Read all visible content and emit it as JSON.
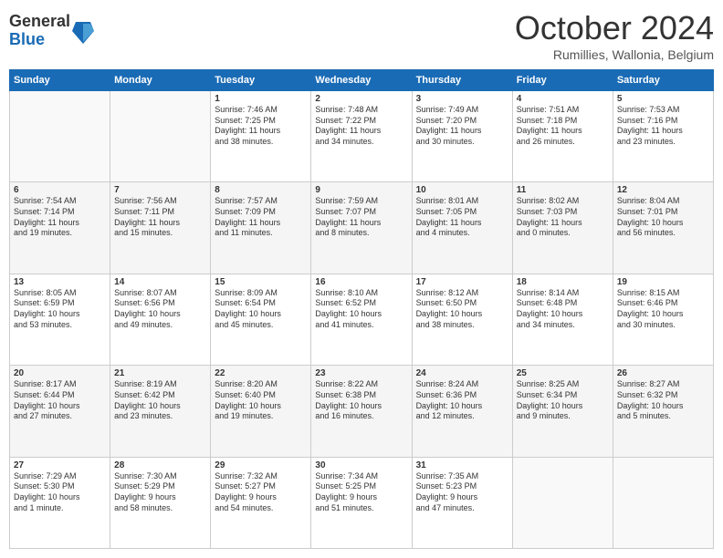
{
  "header": {
    "logo_line1": "General",
    "logo_line2": "Blue",
    "month": "October 2024",
    "location": "Rumillies, Wallonia, Belgium"
  },
  "weekdays": [
    "Sunday",
    "Monday",
    "Tuesday",
    "Wednesday",
    "Thursday",
    "Friday",
    "Saturday"
  ],
  "rows": [
    [
      {
        "day": "",
        "lines": []
      },
      {
        "day": "",
        "lines": []
      },
      {
        "day": "1",
        "lines": [
          "Sunrise: 7:46 AM",
          "Sunset: 7:25 PM",
          "Daylight: 11 hours",
          "and 38 minutes."
        ]
      },
      {
        "day": "2",
        "lines": [
          "Sunrise: 7:48 AM",
          "Sunset: 7:22 PM",
          "Daylight: 11 hours",
          "and 34 minutes."
        ]
      },
      {
        "day": "3",
        "lines": [
          "Sunrise: 7:49 AM",
          "Sunset: 7:20 PM",
          "Daylight: 11 hours",
          "and 30 minutes."
        ]
      },
      {
        "day": "4",
        "lines": [
          "Sunrise: 7:51 AM",
          "Sunset: 7:18 PM",
          "Daylight: 11 hours",
          "and 26 minutes."
        ]
      },
      {
        "day": "5",
        "lines": [
          "Sunrise: 7:53 AM",
          "Sunset: 7:16 PM",
          "Daylight: 11 hours",
          "and 23 minutes."
        ]
      }
    ],
    [
      {
        "day": "6",
        "lines": [
          "Sunrise: 7:54 AM",
          "Sunset: 7:14 PM",
          "Daylight: 11 hours",
          "and 19 minutes."
        ]
      },
      {
        "day": "7",
        "lines": [
          "Sunrise: 7:56 AM",
          "Sunset: 7:11 PM",
          "Daylight: 11 hours",
          "and 15 minutes."
        ]
      },
      {
        "day": "8",
        "lines": [
          "Sunrise: 7:57 AM",
          "Sunset: 7:09 PM",
          "Daylight: 11 hours",
          "and 11 minutes."
        ]
      },
      {
        "day": "9",
        "lines": [
          "Sunrise: 7:59 AM",
          "Sunset: 7:07 PM",
          "Daylight: 11 hours",
          "and 8 minutes."
        ]
      },
      {
        "day": "10",
        "lines": [
          "Sunrise: 8:01 AM",
          "Sunset: 7:05 PM",
          "Daylight: 11 hours",
          "and 4 minutes."
        ]
      },
      {
        "day": "11",
        "lines": [
          "Sunrise: 8:02 AM",
          "Sunset: 7:03 PM",
          "Daylight: 11 hours",
          "and 0 minutes."
        ]
      },
      {
        "day": "12",
        "lines": [
          "Sunrise: 8:04 AM",
          "Sunset: 7:01 PM",
          "Daylight: 10 hours",
          "and 56 minutes."
        ]
      }
    ],
    [
      {
        "day": "13",
        "lines": [
          "Sunrise: 8:05 AM",
          "Sunset: 6:59 PM",
          "Daylight: 10 hours",
          "and 53 minutes."
        ]
      },
      {
        "day": "14",
        "lines": [
          "Sunrise: 8:07 AM",
          "Sunset: 6:56 PM",
          "Daylight: 10 hours",
          "and 49 minutes."
        ]
      },
      {
        "day": "15",
        "lines": [
          "Sunrise: 8:09 AM",
          "Sunset: 6:54 PM",
          "Daylight: 10 hours",
          "and 45 minutes."
        ]
      },
      {
        "day": "16",
        "lines": [
          "Sunrise: 8:10 AM",
          "Sunset: 6:52 PM",
          "Daylight: 10 hours",
          "and 41 minutes."
        ]
      },
      {
        "day": "17",
        "lines": [
          "Sunrise: 8:12 AM",
          "Sunset: 6:50 PM",
          "Daylight: 10 hours",
          "and 38 minutes."
        ]
      },
      {
        "day": "18",
        "lines": [
          "Sunrise: 8:14 AM",
          "Sunset: 6:48 PM",
          "Daylight: 10 hours",
          "and 34 minutes."
        ]
      },
      {
        "day": "19",
        "lines": [
          "Sunrise: 8:15 AM",
          "Sunset: 6:46 PM",
          "Daylight: 10 hours",
          "and 30 minutes."
        ]
      }
    ],
    [
      {
        "day": "20",
        "lines": [
          "Sunrise: 8:17 AM",
          "Sunset: 6:44 PM",
          "Daylight: 10 hours",
          "and 27 minutes."
        ]
      },
      {
        "day": "21",
        "lines": [
          "Sunrise: 8:19 AM",
          "Sunset: 6:42 PM",
          "Daylight: 10 hours",
          "and 23 minutes."
        ]
      },
      {
        "day": "22",
        "lines": [
          "Sunrise: 8:20 AM",
          "Sunset: 6:40 PM",
          "Daylight: 10 hours",
          "and 19 minutes."
        ]
      },
      {
        "day": "23",
        "lines": [
          "Sunrise: 8:22 AM",
          "Sunset: 6:38 PM",
          "Daylight: 10 hours",
          "and 16 minutes."
        ]
      },
      {
        "day": "24",
        "lines": [
          "Sunrise: 8:24 AM",
          "Sunset: 6:36 PM",
          "Daylight: 10 hours",
          "and 12 minutes."
        ]
      },
      {
        "day": "25",
        "lines": [
          "Sunrise: 8:25 AM",
          "Sunset: 6:34 PM",
          "Daylight: 10 hours",
          "and 9 minutes."
        ]
      },
      {
        "day": "26",
        "lines": [
          "Sunrise: 8:27 AM",
          "Sunset: 6:32 PM",
          "Daylight: 10 hours",
          "and 5 minutes."
        ]
      }
    ],
    [
      {
        "day": "27",
        "lines": [
          "Sunrise: 7:29 AM",
          "Sunset: 5:30 PM",
          "Daylight: 10 hours",
          "and 1 minute."
        ]
      },
      {
        "day": "28",
        "lines": [
          "Sunrise: 7:30 AM",
          "Sunset: 5:29 PM",
          "Daylight: 9 hours",
          "and 58 minutes."
        ]
      },
      {
        "day": "29",
        "lines": [
          "Sunrise: 7:32 AM",
          "Sunset: 5:27 PM",
          "Daylight: 9 hours",
          "and 54 minutes."
        ]
      },
      {
        "day": "30",
        "lines": [
          "Sunrise: 7:34 AM",
          "Sunset: 5:25 PM",
          "Daylight: 9 hours",
          "and 51 minutes."
        ]
      },
      {
        "day": "31",
        "lines": [
          "Sunrise: 7:35 AM",
          "Sunset: 5:23 PM",
          "Daylight: 9 hours",
          "and 47 minutes."
        ]
      },
      {
        "day": "",
        "lines": []
      },
      {
        "day": "",
        "lines": []
      }
    ]
  ]
}
